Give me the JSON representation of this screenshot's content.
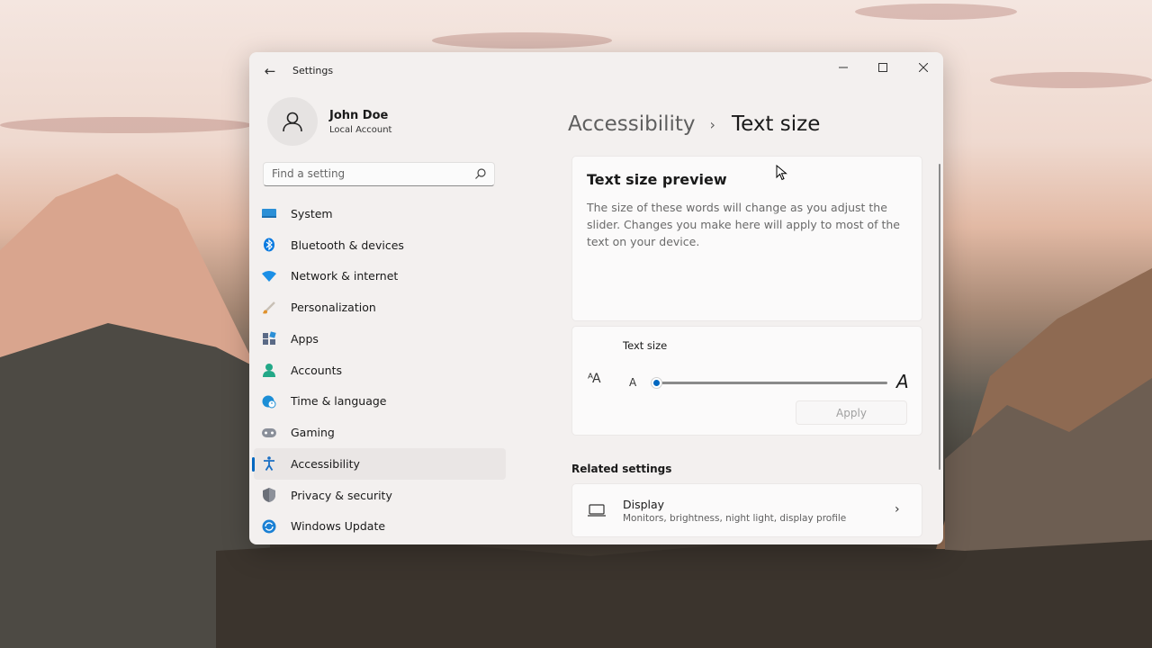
{
  "window": {
    "title": "Settings"
  },
  "profile": {
    "name": "John Doe",
    "account_type": "Local Account"
  },
  "search": {
    "placeholder": "Find a setting"
  },
  "sidebar": {
    "items": [
      {
        "label": "System",
        "icon": "system-icon",
        "color": "#2b8fd6"
      },
      {
        "label": "Bluetooth & devices",
        "icon": "bluetooth-icon",
        "color": "#0a7ae0"
      },
      {
        "label": "Network & internet",
        "icon": "wifi-icon",
        "color": "#1b8fe6"
      },
      {
        "label": "Personalization",
        "icon": "paintbrush-icon",
        "color": "#e0922d"
      },
      {
        "label": "Apps",
        "icon": "apps-icon",
        "color": "#5a6a86"
      },
      {
        "label": "Accounts",
        "icon": "accounts-icon",
        "color": "#23a887"
      },
      {
        "label": "Time & language",
        "icon": "globe-clock-icon",
        "color": "#1c8ed6"
      },
      {
        "label": "Gaming",
        "icon": "gamepad-icon",
        "color": "#7a7f8a"
      },
      {
        "label": "Accessibility",
        "icon": "accessibility-icon",
        "color": "#1a6fc4",
        "active": true
      },
      {
        "label": "Privacy & security",
        "icon": "shield-icon",
        "color": "#6b6f78"
      },
      {
        "label": "Windows Update",
        "icon": "update-icon",
        "color": "#1a80d4"
      }
    ]
  },
  "breadcrumb": {
    "parent": "Accessibility",
    "separator": "›",
    "current": "Text size"
  },
  "preview": {
    "title": "Text size preview",
    "body": "The size of these words will change as you adjust the slider. Changes you make here will apply to most of the text on your device."
  },
  "text_size": {
    "label": "Text size",
    "small_glyph": "A",
    "large_glyph": "A",
    "slider_value_fraction": 0.0,
    "apply_label": "Apply"
  },
  "related": {
    "heading": "Related settings",
    "display": {
      "title": "Display",
      "subtitle": "Monitors, brightness, night light, display profile"
    }
  },
  "colors": {
    "accent": "#0067c0"
  }
}
